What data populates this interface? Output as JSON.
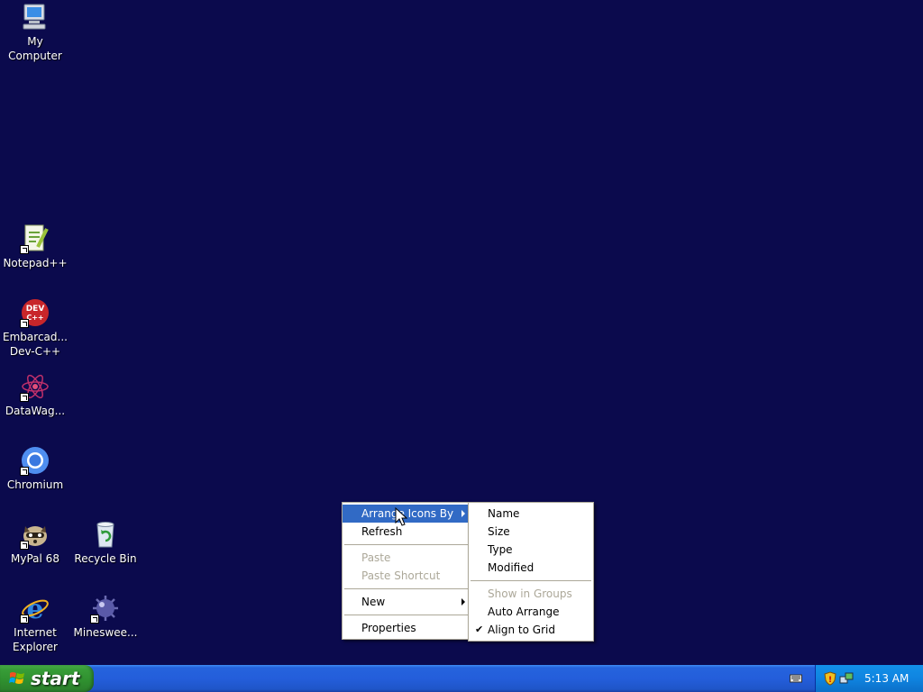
{
  "desktop_icons": [
    {
      "name": "my-computer",
      "label": "My Computer"
    },
    {
      "name": "notepadpp",
      "label": "Notepad++"
    },
    {
      "name": "devcpp",
      "label": "Embarcad... Dev-C++"
    },
    {
      "name": "datawag",
      "label": "DataWag..."
    },
    {
      "name": "chromium",
      "label": "Chromium"
    },
    {
      "name": "mypal",
      "label": "MyPal 68"
    },
    {
      "name": "recycle-bin",
      "label": "Recycle Bin"
    },
    {
      "name": "ie",
      "label": "Internet Explorer"
    },
    {
      "name": "minesweeper",
      "label": "Minesweе..."
    }
  ],
  "context_menu": {
    "arrange": "Arrange Icons By",
    "refresh": "Refresh",
    "paste": "Paste",
    "paste_shortcut": "Paste Shortcut",
    "new": "New",
    "properties": "Properties"
  },
  "submenu": {
    "name": "Name",
    "size": "Size",
    "type": "Type",
    "modified": "Modified",
    "show_in_groups": "Show in Groups",
    "auto_arrange": "Auto Arrange",
    "align_to_grid": "Align to Grid"
  },
  "taskbar": {
    "start_label": "start",
    "clock": "5:13 AM"
  },
  "colors": {
    "desktop": "#0b0a4d",
    "menu_highlight": "#316ac5",
    "taskbar": "#245edb",
    "start_green": "#389e38"
  }
}
